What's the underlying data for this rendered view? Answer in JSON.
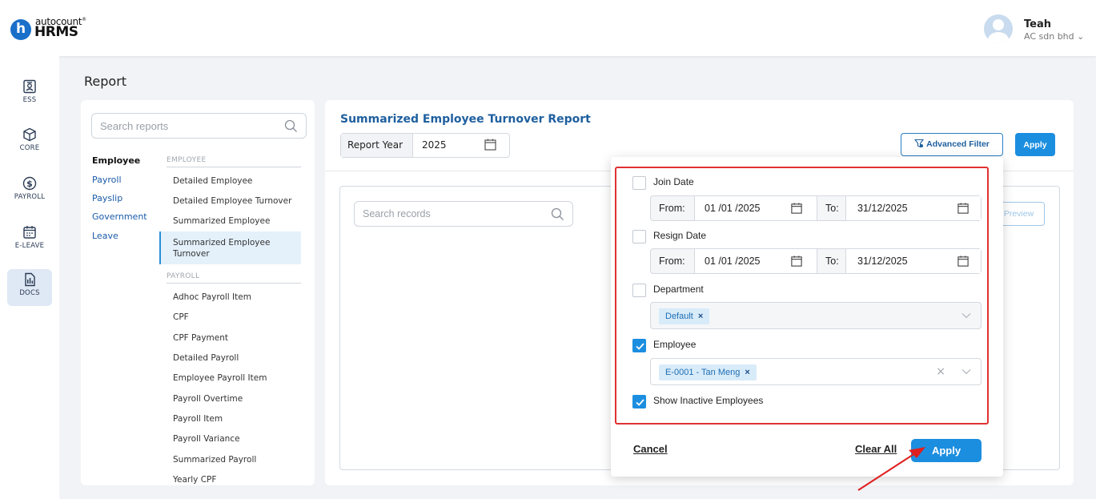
{
  "header": {
    "logo_top": "autocount",
    "logo_bottom": "HRMS",
    "logo_mark": "h",
    "user_name": "Teah",
    "user_company": "AC sdn bhd"
  },
  "rail": [
    {
      "label": "ESS",
      "icon": "id-card-icon"
    },
    {
      "label": "CORE",
      "icon": "cube-icon"
    },
    {
      "label": "PAYROLL",
      "icon": "dollar-coin-icon"
    },
    {
      "label": "E-LEAVE",
      "icon": "calendar-icon"
    },
    {
      "label": "DOCS",
      "icon": "report-doc-icon",
      "active": true
    }
  ],
  "page_title": "Report",
  "nav": {
    "search_placeholder": "Search reports",
    "categories": [
      "Employee",
      "Payroll",
      "Payslip",
      "Government",
      "Leave"
    ],
    "sections": [
      {
        "heading": "EMPLOYEE",
        "items": [
          "Detailed Employee",
          "Detailed Employee Turnover",
          "Summarized Employee",
          "Summarized Employee Turnover"
        ]
      },
      {
        "heading": "PAYROLL",
        "items": [
          "Adhoc Payroll Item",
          "CPF",
          "CPF Payment",
          "Detailed Payroll",
          "Employee Payroll Item",
          "Payroll Overtime",
          "Payroll Item",
          "Payroll Variance",
          "Summarized Payroll",
          "Yearly CPF"
        ]
      }
    ]
  },
  "main": {
    "title": "Summarized Employee Turnover Report",
    "year_label": "Report Year",
    "year_value": "2025",
    "advanced_filter_label": "Advanced Filter",
    "apply_label": "Apply",
    "records_search_placeholder": "Search records",
    "preview_label": "Preview"
  },
  "filter": {
    "join_date": {
      "label": "Join Date",
      "checked": false,
      "from_label": "From:",
      "from_value": "01 /01 /2025",
      "to_label": "To:",
      "to_value": "31/12/2025"
    },
    "resign_date": {
      "label": "Resign Date",
      "checked": false,
      "from_label": "From:",
      "from_value": "01 /01 /2025",
      "to_label": "To:",
      "to_value": "31/12/2025"
    },
    "department": {
      "label": "Department",
      "checked": false,
      "chip": "Default"
    },
    "employee": {
      "label": "Employee",
      "checked": true,
      "chip": "E-0001 - Tan Meng"
    },
    "inactive": {
      "label": "Show Inactive Employees",
      "checked": true
    },
    "cancel_label": "Cancel",
    "clear_all_label": "Clear All",
    "apply_label": "Apply"
  },
  "colors": {
    "accent": "#1c8ee0",
    "title_blue": "#1e5f9e",
    "highlight_red": "#e03131"
  }
}
